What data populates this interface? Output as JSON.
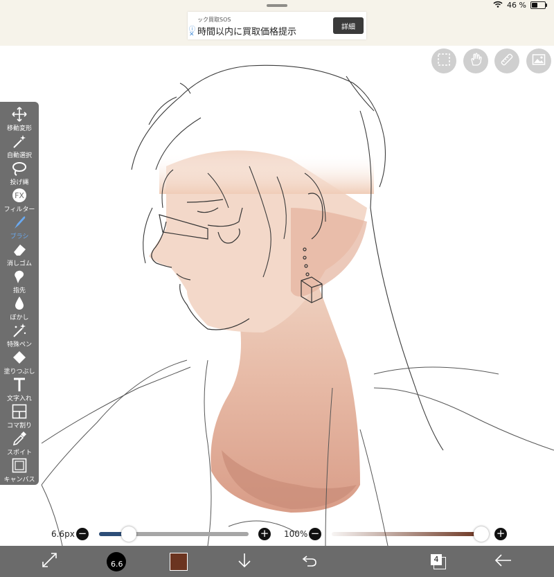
{
  "status": {
    "battery_text": "46 %",
    "battery_level": 0.46
  },
  "ad": {
    "small_text": "ック買取SOS",
    "main_text": "時間以内に買取価格提示",
    "button_label": "詳細"
  },
  "top_tools": [
    "selection-icon",
    "hand-icon",
    "ruler-icon",
    "image-icon"
  ],
  "tools": [
    {
      "label": "移動変形",
      "icon": "move-icon"
    },
    {
      "label": "自動選択",
      "icon": "magic-wand-icon"
    },
    {
      "label": "投げ縄",
      "icon": "lasso-icon"
    },
    {
      "label": "フィルター",
      "icon": "fx-icon"
    },
    {
      "label": "ブラシ",
      "icon": "brush-icon"
    },
    {
      "label": "消しゴム",
      "icon": "eraser-icon"
    },
    {
      "label": "指先",
      "icon": "finger-icon"
    },
    {
      "label": "ぼかし",
      "icon": "blur-drop-icon"
    },
    {
      "label": "特殊ペン",
      "icon": "special-pen-icon"
    },
    {
      "label": "塗りつぶし",
      "icon": "fill-bucket-icon"
    },
    {
      "label": "文字入れ",
      "icon": "text-icon"
    },
    {
      "label": "コマ割り",
      "icon": "frame-divider-icon"
    },
    {
      "label": "スポイト",
      "icon": "eyedropper-icon"
    },
    {
      "label": "キャンバス",
      "icon": "canvas-icon"
    }
  ],
  "active_tool": "ブラシ",
  "brush": {
    "size_label": "6.6px",
    "size_fraction": 0.2,
    "preview_text": "6.6"
  },
  "opacity": {
    "label": "100%",
    "fraction": 1.0
  },
  "colors": {
    "current": "#6b3420",
    "accent_blue": "#2d4e78",
    "tool_active": "#6aa9f0"
  },
  "layers": {
    "count": "4"
  },
  "bottom_icons": [
    "transform-icon",
    "brush-size-icon",
    "color-swatch",
    "download-icon",
    "undo-icon",
    "layers-icon",
    "back-arrow-icon"
  ]
}
